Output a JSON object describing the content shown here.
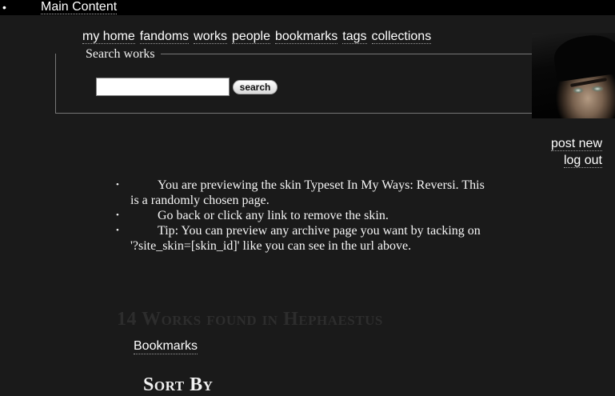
{
  "skip_link": {
    "bullet": "•",
    "label": "Main Content"
  },
  "primary_nav": {
    "items": [
      {
        "label": "my home"
      },
      {
        "label": "fandoms"
      },
      {
        "label": "works"
      },
      {
        "label": "people"
      },
      {
        "label": "bookmarks"
      },
      {
        "label": "tags"
      },
      {
        "label": "collections"
      }
    ]
  },
  "search": {
    "legend": "Search works",
    "input_value": "",
    "button_label": "search"
  },
  "user": {
    "avatar_icon": "user-avatar-icon",
    "links": [
      {
        "label": "post new"
      },
      {
        "label": "log out"
      }
    ]
  },
  "notice": {
    "bullet": "•",
    "items": [
      {
        "text": "You are previewing the skin Typeset In My Ways: Reversi. This is a randomly chosen page."
      },
      {
        "text": "Go back or click any link to remove the skin."
      },
      {
        "text": "Tip: You can preview any archive page you want by tacking on '?site_skin=[skin_id]' like you can see in the url above."
      }
    ]
  },
  "works": {
    "heading": "14 Works found in Hephaestus",
    "bookmarks_label": "Bookmarks",
    "sort_heading": "Sort By"
  },
  "colors": {
    "page_background": "#1a1a1a",
    "header_background": "#000000",
    "text": "#f2f2f2",
    "muted_heading": "#2d2d2d"
  }
}
